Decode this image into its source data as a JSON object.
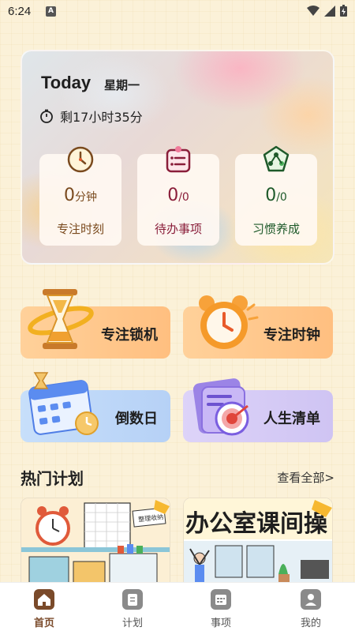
{
  "status_bar": {
    "time": "6:24",
    "notification_badge": "A"
  },
  "today": {
    "title": "Today",
    "weekday": "星期一",
    "remaining": "剩17小时35分",
    "stats": [
      {
        "value": "0",
        "unit": "分钟",
        "label": "专注时刻",
        "color": "#7a4a1e"
      },
      {
        "value": "0",
        "unit": "/0",
        "label": "待办事项",
        "color": "#8a1e3a"
      },
      {
        "value": "0",
        "unit": "/0",
        "label": "习惯养成",
        "color": "#1e5a2a"
      }
    ]
  },
  "features": {
    "focus_lock": "专注锁机",
    "focus_clock": "专注时钟",
    "countdown": "倒数日",
    "life_list": "人生清单"
  },
  "hot_plans": {
    "title": "热门计划",
    "see_all": "查看全部>",
    "cards": [
      {
        "sticker": "整理收纳"
      },
      {
        "banner": "办公室课间操"
      }
    ]
  },
  "bottom_nav": {
    "items": [
      {
        "label": "首页",
        "icon": "home-icon",
        "active": true
      },
      {
        "label": "计划",
        "icon": "plan-icon",
        "active": false
      },
      {
        "label": "事项",
        "icon": "calendar-icon",
        "active": false
      },
      {
        "label": "我的",
        "icon": "profile-icon",
        "active": false
      }
    ]
  },
  "colors": {
    "background": "#fbf1d8",
    "tile_orange": "#ffc98a",
    "tile_blue": "#bcd6f7",
    "tile_purple": "#d6cdf6",
    "nav_active": "#7a4a2a"
  }
}
